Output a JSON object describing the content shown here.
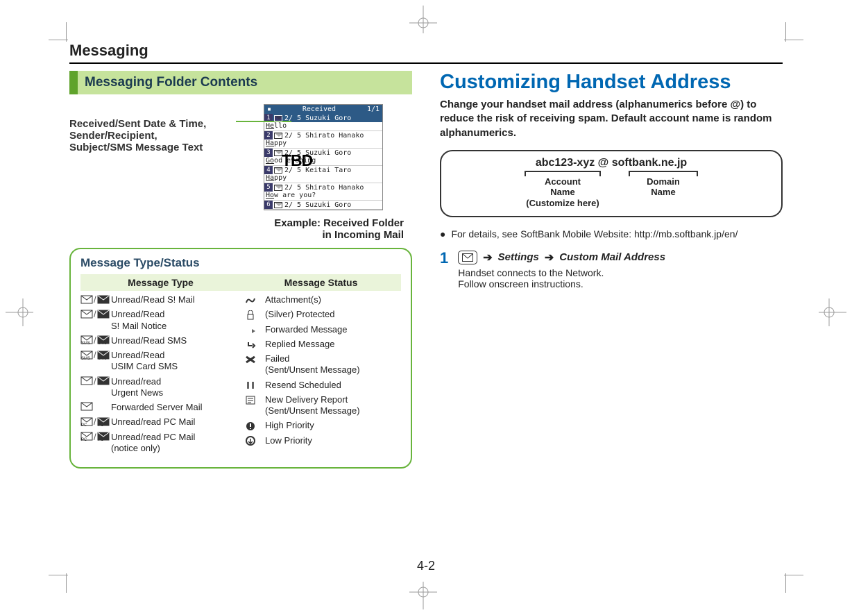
{
  "page_title": "Messaging",
  "page_number": "4-2",
  "left": {
    "section_bar": "Messaging Folder Contents",
    "annotation": "Received/Sent Date & Time,\nSender/Recipient,\nSubject/SMS Message Text",
    "tbd": "TBD",
    "example_line1": "Example: Received Folder",
    "example_line2": "in Incoming Mail",
    "phone": {
      "title_center": "Received",
      "title_right": "1/1",
      "messages": [
        {
          "num": "1",
          "line1": "2/ 5 Suzuki Goro",
          "line2a": "He",
          "line2b": "llo",
          "selected": true
        },
        {
          "num": "2",
          "line1": "2/ 5 Shirato Hanako",
          "line2a": "Ha",
          "line2b": "ppy"
        },
        {
          "num": "3",
          "line1": "2/ 5 Suzuki Goro",
          "line2a": "Go",
          "line2b": "od evening"
        },
        {
          "num": "4",
          "line1": "2/ 5 Keitai Taro",
          "line2a": "Ha",
          "line2b": "ppy"
        },
        {
          "num": "5",
          "line1": "2/ 5 Shirato Hanako",
          "line2a": "Ho",
          "line2b": "w are you?"
        },
        {
          "num": "6",
          "line1": "2/ 5 Suzuki Goro",
          "line2a": "",
          "line2b": "",
          "hide_line2": true
        }
      ]
    },
    "typebox": {
      "title": "Message Type/Status",
      "head_type": "Message Type",
      "head_status": "Message Status",
      "types": [
        "Unread/Read S! Mail",
        "Unread/Read\nS! Mail Notice",
        "Unread/Read SMS",
        "Unread/Read\nUSIM Card SMS",
        "Unread/read\nUrgent News",
        "Forwarded Server Mail",
        "Unread/read PC Mail",
        "Unread/read PC Mail\n(notice only)"
      ],
      "statuses": [
        "Attachment(s)",
        "(Silver) Protected",
        "Forwarded Message",
        "Replied Message",
        "Failed\n(Sent/Unsent Message)",
        "Resend Scheduled",
        "New Delivery Report\n(Sent/Unsent Message)",
        "High Priority",
        "Low Priority"
      ]
    }
  },
  "right": {
    "heading": "Customizing Handset Address",
    "lead": "Change your handset mail address (alphanumerics before @) to reduce the risk of receiving spam. Default account name is random alphanumerics.",
    "address_example": "abc123-xyz @ softbank.ne.jp",
    "account_label_1": "Account",
    "account_label_2": "Name",
    "account_label_3": "(Customize here)",
    "domain_label_1": "Domain",
    "domain_label_2": "Name",
    "bullet": "For details, see SoftBank Mobile Website: http://mb.softbank.jp/en/",
    "step1_num": "1",
    "step1_item1": "Settings",
    "step1_item2": "Custom Mail Address",
    "step1_sub1": "Handset connects to the Network.",
    "step1_sub2": "Follow onscreen instructions."
  }
}
